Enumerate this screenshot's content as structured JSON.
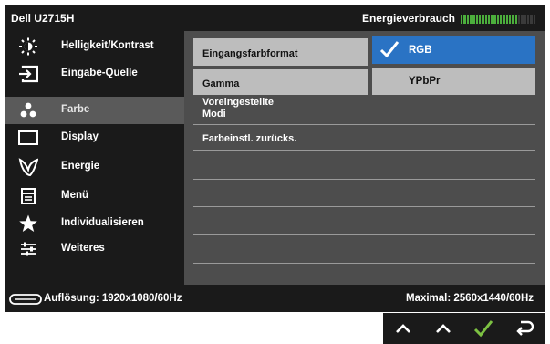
{
  "title": {
    "model": "Dell U2715H",
    "energy_label": "Energieverbrauch"
  },
  "energy_meter": {
    "level": 0.76,
    "segments": 25,
    "active_color": "#4caf3c",
    "inactive_color": "#3a3a3a"
  },
  "sidebar": {
    "items": [
      {
        "label": "Helligkeit/Kontrast",
        "icon": "brightness-icon"
      },
      {
        "label": "Eingabe-Quelle",
        "icon": "input-source-icon"
      },
      {
        "label": "Farbe",
        "icon": "color-icon",
        "active": true
      },
      {
        "label": "Display",
        "icon": "display-icon"
      },
      {
        "label": "Energie",
        "icon": "energy-leaf-icon"
      },
      {
        "label": "Menü",
        "icon": "menu-icon"
      },
      {
        "label": "Individualisieren",
        "icon": "star-icon"
      },
      {
        "label": "Weiteres",
        "icon": "sliders-icon"
      }
    ]
  },
  "submenu": {
    "items": [
      {
        "label": "Eingangsfarbformat",
        "selected": true
      },
      {
        "label": "Gamma"
      },
      {
        "label": "Voreingestellte Modi"
      },
      {
        "label": "Farbeinstl. zurücks."
      }
    ]
  },
  "options": {
    "items": [
      {
        "label": "RGB",
        "checked": true
      },
      {
        "label": "YPbPr"
      }
    ]
  },
  "status": {
    "resolution": "Auflösung: 1920x1080/60Hz",
    "maximum": "Maximal: 2560x1440/60Hz"
  },
  "buttons": [
    {
      "name": "up-arrow-icon"
    },
    {
      "name": "up-arrow-icon"
    },
    {
      "name": "check-icon",
      "color": "#7cc142"
    },
    {
      "name": "back-icon"
    }
  ],
  "colors": {
    "accent": "#2a73c4",
    "highlight": "#bdbdbd",
    "panel": "#4d4d4d",
    "frame": "#1a1a1a"
  }
}
